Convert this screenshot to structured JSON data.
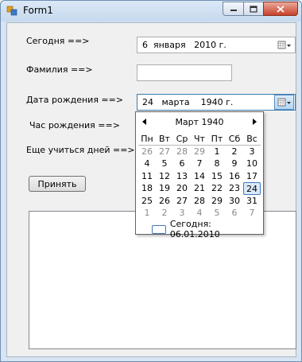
{
  "window": {
    "title": "Form1"
  },
  "form": {
    "today_label": "Сегодня ==>",
    "today_value": "6  января   2010 г.",
    "surname_label": "Фамилия ==>",
    "surname_value": "",
    "birthdate_label": "Дата рождения ==>",
    "birthdate_value": "24   марта    1940 г.",
    "birthhour_label": "Час рождения ==>",
    "days_label": "Еще учиться дней ==>",
    "accept_button": "Принять",
    "output_text": ""
  },
  "calendar": {
    "title": "Март 1940",
    "weekdays": [
      "Пн",
      "Вт",
      "Ср",
      "Чт",
      "Пт",
      "Сб",
      "Вс"
    ],
    "weeks": [
      [
        "26",
        "27",
        "28",
        "29",
        "1",
        "2",
        "3"
      ],
      [
        "4",
        "5",
        "6",
        "7",
        "8",
        "9",
        "10"
      ],
      [
        "11",
        "12",
        "13",
        "14",
        "15",
        "16",
        "17"
      ],
      [
        "18",
        "19",
        "20",
        "21",
        "22",
        "23",
        "24"
      ],
      [
        "25",
        "26",
        "27",
        "28",
        "29",
        "30",
        "31"
      ],
      [
        "1",
        "2",
        "3",
        "4",
        "5",
        "6",
        "7"
      ]
    ],
    "other_month": [
      [
        true,
        true,
        true,
        true,
        false,
        false,
        false
      ],
      [
        false,
        false,
        false,
        false,
        false,
        false,
        false
      ],
      [
        false,
        false,
        false,
        false,
        false,
        false,
        false
      ],
      [
        false,
        false,
        false,
        false,
        false,
        false,
        false
      ],
      [
        false,
        false,
        false,
        false,
        false,
        false,
        false
      ],
      [
        true,
        true,
        true,
        true,
        true,
        true,
        true
      ]
    ],
    "selected_day": "24",
    "today_text": "Сегодня: 06.01.2010"
  }
}
